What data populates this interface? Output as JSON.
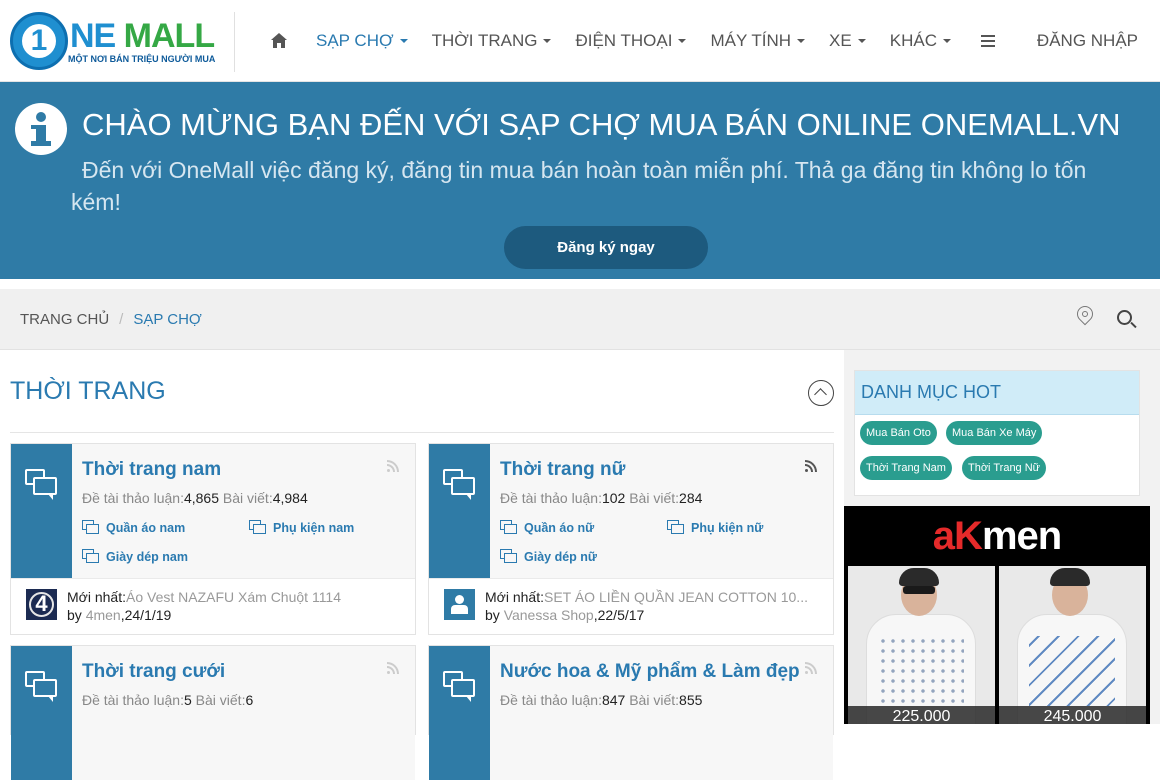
{
  "header": {
    "logo": {
      "digit": "1",
      "name_part1": "NE",
      "name_part2": " MALL",
      "tagline": "MỘT NƠI BÁN TRIỆU NGƯỜI MUA"
    },
    "nav": [
      {
        "label": "SẠP CHỢ",
        "active": true
      },
      {
        "label": "THỜI TRANG",
        "active": false
      },
      {
        "label": "ĐIỆN THOẠI",
        "active": false
      },
      {
        "label": "MÁY TÍNH",
        "active": false
      },
      {
        "label": "XE",
        "active": false
      },
      {
        "label": "KHÁC",
        "active": false
      }
    ],
    "login": "ĐĂNG NHẬP"
  },
  "banner": {
    "title": "CHÀO MỪNG BẠN ĐẾN VỚI SẠP CHỢ MUA BÁN ONLINE ONEMALL.VN",
    "subtitle": "Đến với OneMall việc đăng ký, đăng tin mua bán hoàn toàn miễn phí. Thả ga đăng tin không lo tốn kém!",
    "button": "Đăng ký ngay"
  },
  "breadcrumb": {
    "home": "TRANG CHỦ",
    "separator": "/",
    "current": "SẠP CHỢ"
  },
  "section": {
    "title": "THỜI TRANG",
    "forums": [
      {
        "name": "Thời trang nam",
        "topics_label": "Đề tài thảo luận:",
        "topics": "4,865",
        "posts_label": "Bài viết:",
        "posts": "4,984",
        "subforums": [
          "Quần áo nam",
          "Phụ kiện nam",
          "Giày dép nam"
        ],
        "latest_label": "Mới nhất:",
        "latest_title": "Áo Vest NAZAFU Xám Chuột 1114",
        "by_label": "by",
        "latest_user": "4men",
        "latest_date": ",24/1/19",
        "avatar_glyph": "4"
      },
      {
        "name": "Thời trang nữ",
        "topics_label": "Đề tài thảo luận:",
        "topics": "102",
        "posts_label": "Bài viết:",
        "posts": "284",
        "subforums": [
          "Quần áo nữ",
          "Phụ kiện nữ",
          "Giày dép nữ"
        ],
        "latest_label": "Mới nhất:",
        "latest_title": "SET ÁO LIỀN QUẦN JEAN COTTON 10...",
        "by_label": "by",
        "latest_user": "Vanessa Shop",
        "latest_date": ",22/5/17"
      },
      {
        "name": "Thời trang cưới",
        "topics_label": "Đề tài thảo luận:",
        "topics": "5",
        "posts_label": "Bài viết:",
        "posts": "6"
      },
      {
        "name": "Nước hoa & Mỹ phẩm & Làm đẹp",
        "topics_label": "Đề tài thảo luận:",
        "topics": "847",
        "posts_label": "Bài viết:",
        "posts": "855"
      }
    ]
  },
  "sidebar": {
    "hot_title": "DANH MỤC HOT",
    "tags": [
      "Mua Bán Oto",
      "Mua Bán Xe Máy",
      "Thời Trang Nam",
      "Thời Trang Nữ"
    ],
    "ad": {
      "brand_a": "a",
      "brand_k": "K",
      "brand_rest": "men",
      "products": [
        {
          "price": "225.000"
        },
        {
          "price": "245.000"
        }
      ]
    }
  },
  "colors": {
    "primary": "#2f7ba6",
    "link": "#2a7ab0",
    "tag": "#2a9d8f",
    "hot_header": "#d0ecf8"
  }
}
